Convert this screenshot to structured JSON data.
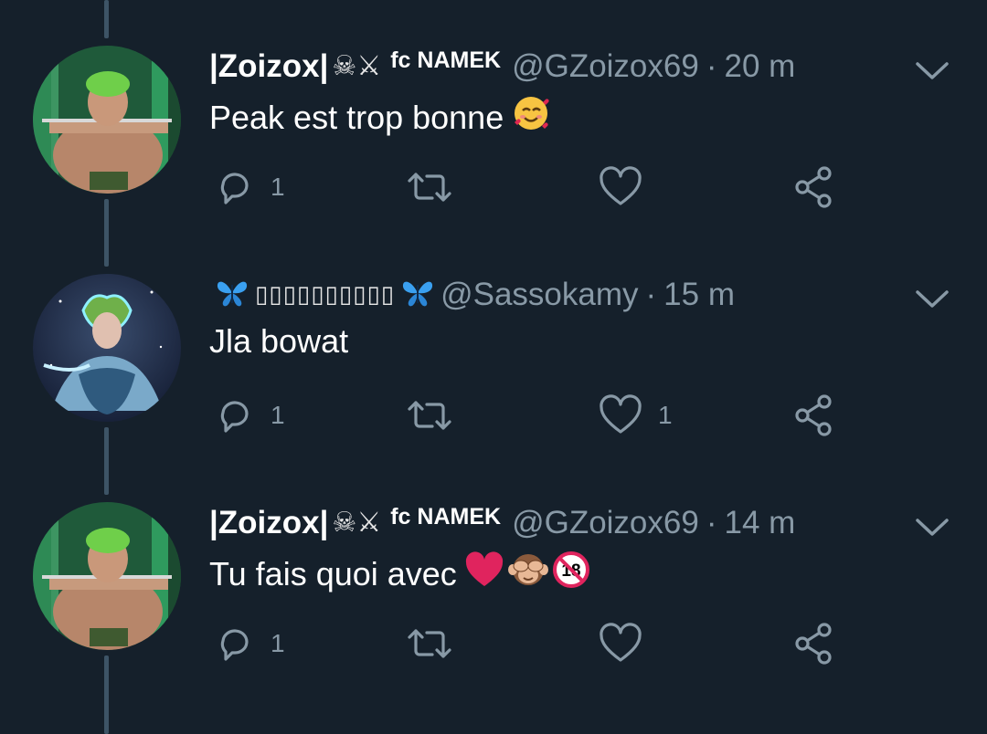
{
  "tweets": [
    {
      "name": "|Zoizox|",
      "name_emojis": "☠⚔",
      "name_suffix": "fc NAMEK",
      "handle": "@GZoizox69",
      "separator": "·",
      "time": "20 m",
      "text": "Peak est trop bonne",
      "text_emojis": [
        "smiling-face-with-hearts"
      ],
      "replies": "1",
      "retweets": "",
      "likes": ""
    },
    {
      "name_emojis_left": "butterfly",
      "name": "▯▯▯▯▯▯▯▯▯▯",
      "name_emojis_right": "butterfly",
      "handle": "@Sassokamy",
      "separator": "·",
      "time": "15 m",
      "text": "Jla bowat",
      "replies": "1",
      "retweets": "",
      "likes": "1"
    },
    {
      "name": "|Zoizox|",
      "name_emojis": "☠⚔",
      "name_suffix": "fc NAMEK",
      "handle": "@GZoizox69",
      "separator": "·",
      "time": "14 m",
      "text": "Tu fais quoi avec",
      "text_emojis": [
        "red-heart",
        "see-no-evil-monkey",
        "no-one-under-eighteen"
      ],
      "replies": "1",
      "retweets": "",
      "likes": ""
    }
  ],
  "colors": {
    "background": "#15202b",
    "secondary_text": "#8899a6",
    "thread_line": "#3d5466"
  }
}
